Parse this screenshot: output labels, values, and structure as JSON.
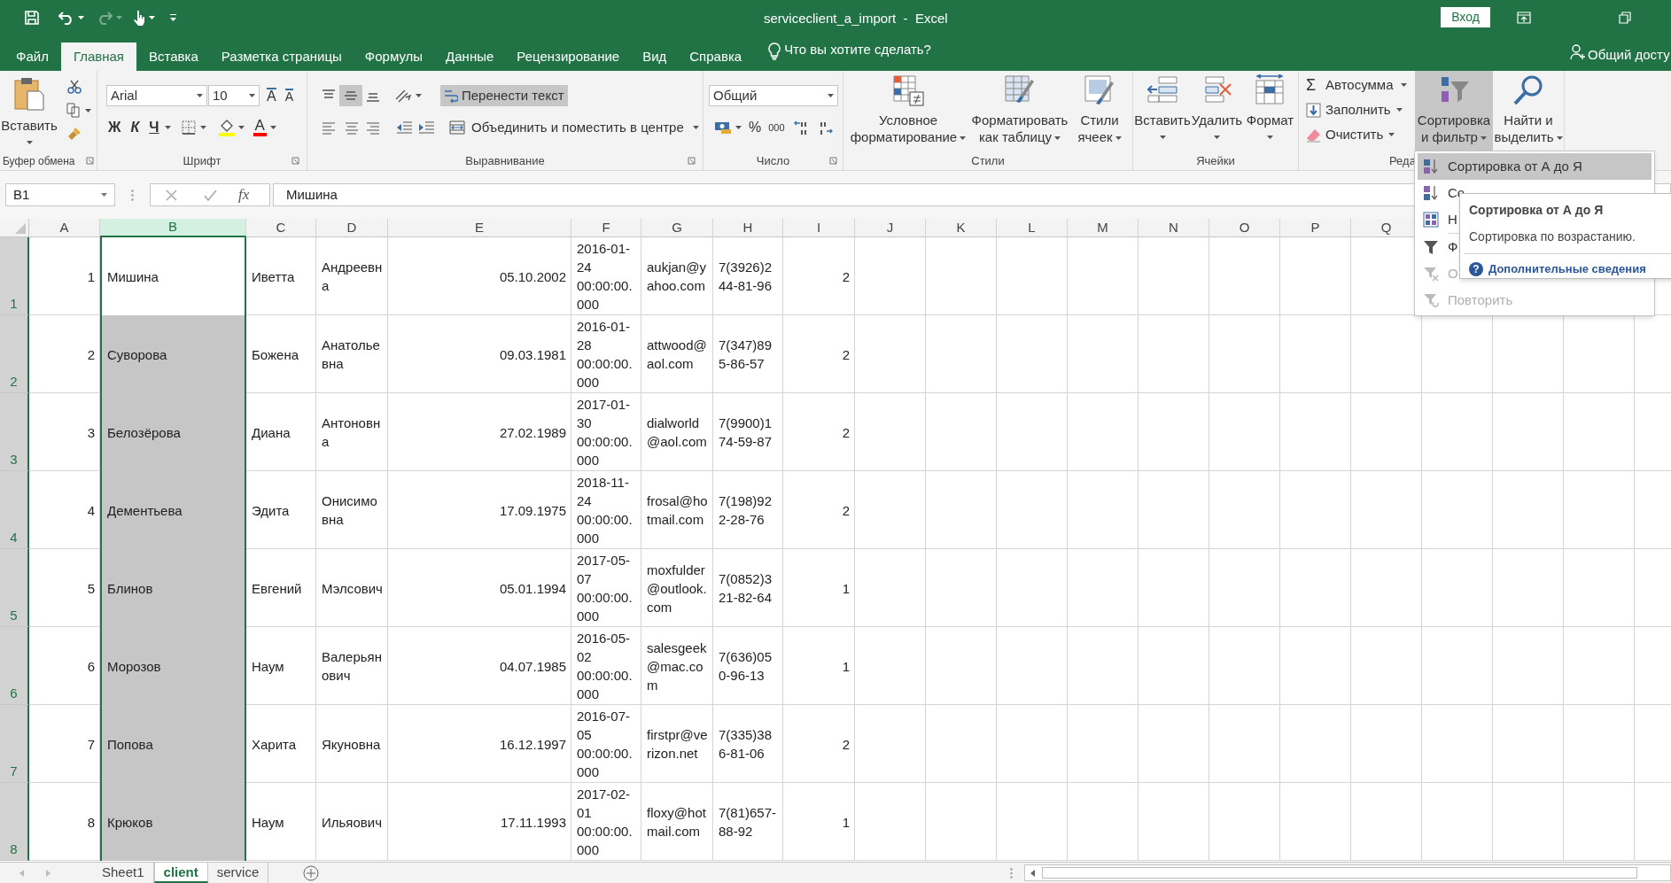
{
  "window": {
    "title": "serviceclient_a_import  -  Excel",
    "sign_in": "Вход"
  },
  "quick_access": {
    "undo": {
      "disabled": false
    },
    "redo": {
      "disabled": true
    }
  },
  "ribbon_tabs": [
    {
      "label": "Файл",
      "selected": false
    },
    {
      "label": "Главная",
      "selected": true
    },
    {
      "label": "Вставка",
      "selected": false
    },
    {
      "label": "Разметка страницы",
      "selected": false
    },
    {
      "label": "Формулы",
      "selected": false
    },
    {
      "label": "Данные",
      "selected": false
    },
    {
      "label": "Рецензирование",
      "selected": false
    },
    {
      "label": "Вид",
      "selected": false
    },
    {
      "label": "Справка",
      "selected": false
    }
  ],
  "tell_me": "Что вы хотите сделать?",
  "share": "Общий досту",
  "ribbon": {
    "clipboard": {
      "label": "Буфер обмена",
      "paste": "Вставить"
    },
    "font": {
      "label": "Шрифт",
      "font_name": "Arial",
      "font_size": "10",
      "grow": "A",
      "shrink": "A",
      "bold": "Ж",
      "italic": "К",
      "underline": "Ч",
      "font_color": "A"
    },
    "alignment": {
      "label": "Выравнивание",
      "middle_align": {
        "pressed": true
      },
      "wrap_text": {
        "label": "Перенести текст",
        "pressed": true
      },
      "merge": "Объединить и поместить в центре"
    },
    "number": {
      "label": "Число",
      "format": "Общий",
      "percent": "%",
      "thousands": "000"
    },
    "styles": {
      "label": "Стили",
      "conditional": "Условное форматирование",
      "as_table": "Форматировать как таблицу",
      "cell_styles": "Стили ячеек"
    },
    "cells": {
      "label": "Ячейки",
      "insert": "Вставить",
      "delete": "Удалить",
      "format": "Формат"
    },
    "editing": {
      "label": "Реда",
      "sigma": "Σ",
      "autosum": "Автосумма",
      "fill": "Заполнить",
      "clear": "Очистить",
      "sort_filter": {
        "label": "Сортировка и фильтр",
        "pressed": true
      },
      "find": "Найти и выделить"
    }
  },
  "formula_bar": {
    "name_box": "B1",
    "fx": "fx",
    "value": "Мишина"
  },
  "grid": {
    "columns": [
      {
        "label": "A",
        "selected": false
      },
      {
        "label": "B",
        "selected": true
      },
      {
        "label": "C",
        "selected": false
      },
      {
        "label": "D",
        "selected": false
      },
      {
        "label": "E",
        "selected": false
      },
      {
        "label": "F",
        "selected": false
      },
      {
        "label": "G",
        "selected": false
      },
      {
        "label": "H",
        "selected": false
      },
      {
        "label": "I",
        "selected": false
      },
      {
        "label": "J",
        "selected": false
      },
      {
        "label": "K",
        "selected": false
      },
      {
        "label": "L",
        "selected": false
      },
      {
        "label": "M",
        "selected": false
      },
      {
        "label": "N",
        "selected": false
      },
      {
        "label": "O",
        "selected": false
      },
      {
        "label": "P",
        "selected": false
      },
      {
        "label": "Q",
        "selected": false
      }
    ],
    "rows": [
      {
        "header": "1",
        "selected": true,
        "active": true,
        "cells": [
          "1",
          "Мишина",
          "Иветта",
          "Андреевна",
          "05.10.2002",
          "2016-01-24 00:00:00.000",
          "aukjan@yahoo.com",
          "7(3926)244-81-96",
          "2"
        ]
      },
      {
        "header": "2",
        "selected": true,
        "active": false,
        "cells": [
          "2",
          "Суворова",
          "Божена",
          "Анатольевна",
          "09.03.1981",
          "2016-01-28 00:00:00.000",
          "attwood@aol.com",
          "7(347)895-86-57",
          "2"
        ]
      },
      {
        "header": "3",
        "selected": true,
        "active": false,
        "cells": [
          "3",
          "Белозёрова",
          "Диана",
          "Антоновна",
          "27.02.1989",
          "2017-01-30 00:00:00.000",
          "dialworld@aol.com",
          "7(9900)174-59-87",
          "2"
        ]
      },
      {
        "header": "4",
        "selected": true,
        "active": false,
        "cells": [
          "4",
          "Дементьева",
          "Эдита",
          "Онисимовна",
          "17.09.1975",
          "2018-11-24 00:00:00.000",
          "frosal@hotmail.com",
          "7(198)922-28-76",
          "2"
        ]
      },
      {
        "header": "5",
        "selected": true,
        "active": false,
        "cells": [
          "5",
          "Блинов",
          "Евгений",
          "Мэлсович",
          "05.01.1994",
          "2017-05-07 00:00:00.000",
          "moxfulder@outlook.com",
          "7(0852)321-82-64",
          "1"
        ]
      },
      {
        "header": "6",
        "selected": true,
        "active": false,
        "cells": [
          "6",
          "Морозов",
          "Наум",
          "Валерьянович",
          "04.07.1985",
          "2016-05-02 00:00:00.000",
          "salesgeek@mac.com",
          "7(636)050-96-13",
          "1"
        ]
      },
      {
        "header": "7",
        "selected": true,
        "active": false,
        "cells": [
          "7",
          "Попова",
          "Харита",
          "Якуновна",
          "16.12.1997",
          "2016-07-05 00:00:00.000",
          "firstpr@verizon.net",
          "7(335)386-81-06",
          "2"
        ]
      },
      {
        "header": "8",
        "selected": true,
        "active": false,
        "cells": [
          "8",
          "Крюков",
          "Наум",
          "Ильяович",
          "17.11.1993",
          "2017-02-01 00:00:00.000",
          "floxy@hotmail.com",
          "7(81)657-88-92",
          "1"
        ]
      }
    ]
  },
  "sheet_tabs": [
    {
      "label": "Sheet1",
      "selected": false
    },
    {
      "label": "client",
      "selected": true
    },
    {
      "label": "service",
      "selected": false
    }
  ],
  "sort_menu": [
    {
      "kind": "sort_asc",
      "label": "Сортировка от А до Я",
      "selected": true,
      "disabled": false
    },
    {
      "kind": "sort_desc",
      "label": "Со",
      "selected": false,
      "disabled": false
    },
    {
      "kind": "custom_sort",
      "label": "Н",
      "selected": false,
      "disabled": false
    },
    {
      "kind": "filter",
      "label": "Ф",
      "selected": false,
      "disabled": false
    },
    {
      "kind": "clear",
      "label": "О",
      "selected": false,
      "disabled": true
    },
    {
      "kind": "reapply",
      "label": "Повторить",
      "selected": false,
      "disabled": true
    }
  ],
  "tooltip": {
    "title": "Сортировка от А до Я",
    "description": "Сортировка по возрастанию.",
    "help_mark": "?",
    "link": "Дополнительные сведения"
  }
}
